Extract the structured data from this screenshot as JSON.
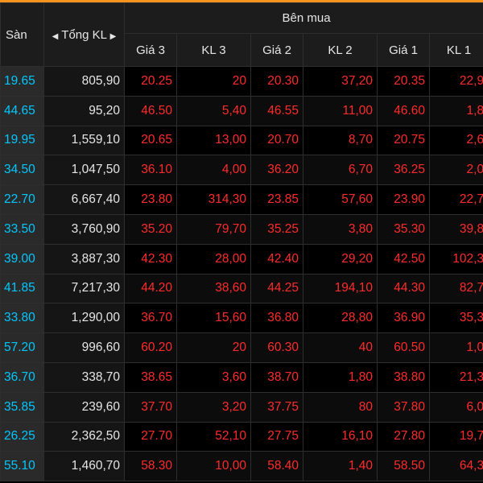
{
  "colors": {
    "accent": "#f7941d",
    "floor": "#00c8ff",
    "down": "#ff2b2b",
    "text": "#e6e6e6"
  },
  "header": {
    "san": "Sàn",
    "tong_kl": "Tổng KL",
    "ben_mua": "Bên mua",
    "gia3": "Giá 3",
    "kl3": "KL 3",
    "gia2": "Giá 2",
    "kl2": "KL 2",
    "gia1": "Giá 1",
    "kl1": "KL 1"
  },
  "rows": [
    {
      "san": "19.65",
      "tong_kl": "805,90",
      "gia3": "20.25",
      "kl3": "20",
      "gia2": "20.30",
      "kl2": "37,20",
      "gia1": "20.35",
      "kl1": "22,9"
    },
    {
      "san": "44.65",
      "tong_kl": "95,20",
      "gia3": "46.50",
      "kl3": "5,40",
      "gia2": "46.55",
      "kl2": "11,00",
      "gia1": "46.60",
      "kl1": "1,8"
    },
    {
      "san": "19.95",
      "tong_kl": "1,559,10",
      "gia3": "20.65",
      "kl3": "13,00",
      "gia2": "20.70",
      "kl2": "8,70",
      "gia1": "20.75",
      "kl1": "2,6"
    },
    {
      "san": "34.50",
      "tong_kl": "1,047,50",
      "gia3": "36.10",
      "kl3": "4,00",
      "gia2": "36.20",
      "kl2": "6,70",
      "gia1": "36.25",
      "kl1": "2,0"
    },
    {
      "san": "22.70",
      "tong_kl": "6,667,40",
      "gia3": "23.80",
      "kl3": "314,30",
      "gia2": "23.85",
      "kl2": "57,60",
      "gia1": "23.90",
      "kl1": "22,7"
    },
    {
      "san": "33.50",
      "tong_kl": "3,760,90",
      "gia3": "35.20",
      "kl3": "79,70",
      "gia2": "35.25",
      "kl2": "3,80",
      "gia1": "35.30",
      "kl1": "39,8"
    },
    {
      "san": "39.00",
      "tong_kl": "3,887,30",
      "gia3": "42.30",
      "kl3": "28,00",
      "gia2": "42.40",
      "kl2": "29,20",
      "gia1": "42.50",
      "kl1": "102,3"
    },
    {
      "san": "41.85",
      "tong_kl": "7,217,30",
      "gia3": "44.20",
      "kl3": "38,60",
      "gia2": "44.25",
      "kl2": "194,10",
      "gia1": "44.30",
      "kl1": "82,7"
    },
    {
      "san": "33.80",
      "tong_kl": "1,290,00",
      "gia3": "36.70",
      "kl3": "15,60",
      "gia2": "36.80",
      "kl2": "28,80",
      "gia1": "36.90",
      "kl1": "35,3"
    },
    {
      "san": "57.20",
      "tong_kl": "996,60",
      "gia3": "60.20",
      "kl3": "20",
      "gia2": "60.30",
      "kl2": "40",
      "gia1": "60.50",
      "kl1": "1,0"
    },
    {
      "san": "36.70",
      "tong_kl": "338,70",
      "gia3": "38.65",
      "kl3": "3,60",
      "gia2": "38.70",
      "kl2": "1,80",
      "gia1": "38.80",
      "kl1": "21,3"
    },
    {
      "san": "35.85",
      "tong_kl": "239,60",
      "gia3": "37.70",
      "kl3": "3,20",
      "gia2": "37.75",
      "kl2": "80",
      "gia1": "37.80",
      "kl1": "6,0"
    },
    {
      "san": "26.25",
      "tong_kl": "2,362,50",
      "gia3": "27.70",
      "kl3": "52,10",
      "gia2": "27.75",
      "kl2": "16,10",
      "gia1": "27.80",
      "kl1": "19,7"
    },
    {
      "san": "55.10",
      "tong_kl": "1,460,70",
      "gia3": "58.30",
      "kl3": "10,00",
      "gia2": "58.40",
      "kl2": "1,40",
      "gia1": "58.50",
      "kl1": "64,3"
    }
  ]
}
